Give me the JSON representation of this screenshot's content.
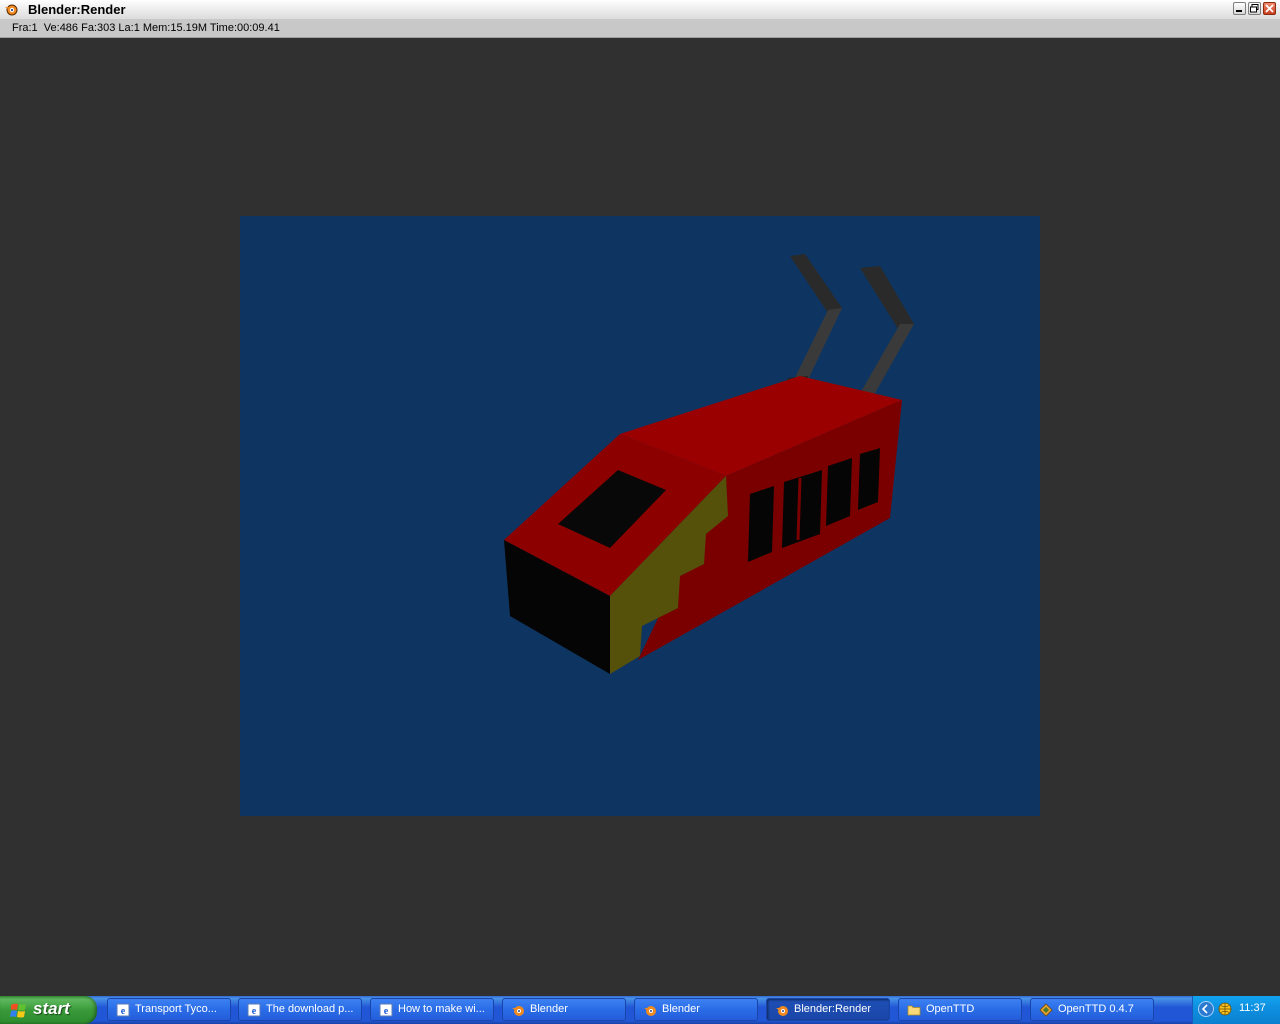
{
  "window": {
    "title": "Blender:Render",
    "info": "Fra:1  Ve:486 Fa:303 La:1 Mem:15.19M Time:00:09.41",
    "controls": {
      "minimize": "0",
      "restore": "1",
      "close": "r"
    }
  },
  "render": {
    "background_color": "#0e3561",
    "subject": "red tram model with pantographs"
  },
  "taskbar": {
    "start_label": "start",
    "tasks": [
      {
        "label": "Transport Tyco...",
        "icon": "ie-icon"
      },
      {
        "label": "The download p...",
        "icon": "ie-icon"
      },
      {
        "label": "How to make wi...",
        "icon": "ie-icon"
      },
      {
        "label": "Blender",
        "icon": "blender-icon"
      },
      {
        "label": "Blender",
        "icon": "blender-icon"
      },
      {
        "label": "Blender:Render",
        "icon": "blender-icon",
        "active": true
      },
      {
        "label": "OpenTTD",
        "icon": "folder-icon"
      },
      {
        "label": "OpenTTD 0.4.7",
        "icon": "openttd-icon"
      }
    ],
    "clock": "11:37"
  },
  "colors": {
    "window_bg": "#303030",
    "taskbar_blue": "#2157d7",
    "start_green": "#3a9a3a",
    "tram_red": "#8c0000",
    "tram_yellow": "#55500a"
  }
}
